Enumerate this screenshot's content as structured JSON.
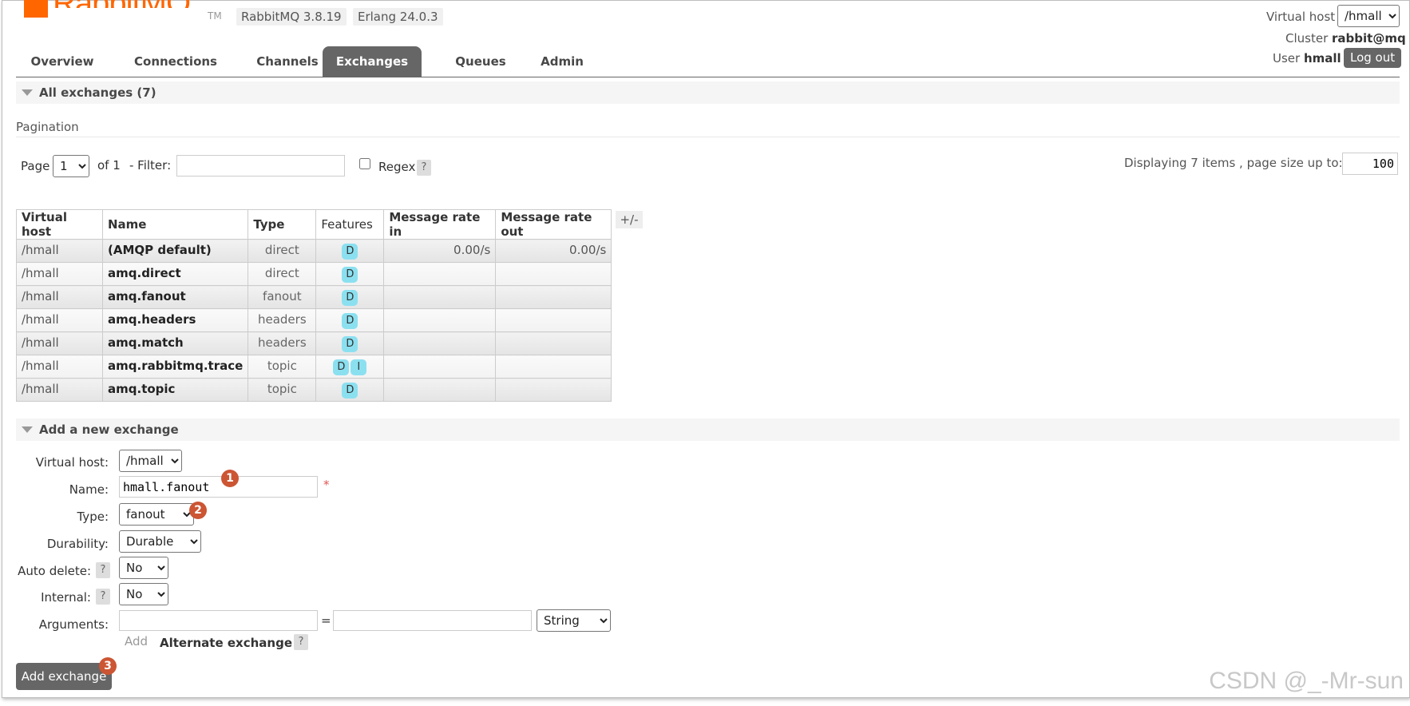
{
  "header": {
    "logo_text": "RabbitMQ",
    "logo_tm": "TM",
    "rabbitmq_version": "RabbitMQ 3.8.19",
    "erlang_version": "Erlang 24.0.3",
    "virtual_host_label": "Virtual host",
    "virtual_host_value": "/hmall",
    "cluster_label": "Cluster",
    "cluster_value": "rabbit@mq",
    "user_label": "User",
    "user_value": "hmall",
    "logout_label": "Log out"
  },
  "tabs": [
    {
      "label": "Overview"
    },
    {
      "label": "Connections"
    },
    {
      "label": "Channels"
    },
    {
      "label": "Exchanges",
      "active": true
    },
    {
      "label": "Queues"
    },
    {
      "label": "Admin"
    }
  ],
  "all_exchanges": {
    "title": "All exchanges (7)",
    "pagination_label": "Pagination",
    "page_label": "Page",
    "page_value": "1",
    "of_label": "of 1",
    "filter_label": "- Filter:",
    "filter_value": "",
    "regex_label": "Regex",
    "help_glyph": "?",
    "displaying_label": "Displaying 7 items , page size up to:",
    "page_size": "100",
    "plusminus": "+/-",
    "columns": [
      "Virtual host",
      "Name",
      "Type",
      "Features",
      "Message rate in",
      "Message rate out"
    ],
    "rows": [
      {
        "vhost": "/hmall",
        "name": "(AMQP default)",
        "type": "direct",
        "features": [
          "D"
        ],
        "rate_in": "0.00/s",
        "rate_out": "0.00/s"
      },
      {
        "vhost": "/hmall",
        "name": "amq.direct",
        "type": "direct",
        "features": [
          "D"
        ],
        "rate_in": "",
        "rate_out": ""
      },
      {
        "vhost": "/hmall",
        "name": "amq.fanout",
        "type": "fanout",
        "features": [
          "D"
        ],
        "rate_in": "",
        "rate_out": ""
      },
      {
        "vhost": "/hmall",
        "name": "amq.headers",
        "type": "headers",
        "features": [
          "D"
        ],
        "rate_in": "",
        "rate_out": ""
      },
      {
        "vhost": "/hmall",
        "name": "amq.match",
        "type": "headers",
        "features": [
          "D"
        ],
        "rate_in": "",
        "rate_out": ""
      },
      {
        "vhost": "/hmall",
        "name": "amq.rabbitmq.trace",
        "type": "topic",
        "features": [
          "D",
          "I"
        ],
        "rate_in": "",
        "rate_out": ""
      },
      {
        "vhost": "/hmall",
        "name": "amq.topic",
        "type": "topic",
        "features": [
          "D"
        ],
        "rate_in": "",
        "rate_out": ""
      }
    ]
  },
  "add_exchange": {
    "title": "Add a new exchange",
    "vhost_label": "Virtual host:",
    "vhost_value": "/hmall",
    "name_label": "Name:",
    "name_value": "hmall.fanout",
    "required_mark": "*",
    "type_label": "Type:",
    "type_value": "fanout",
    "durability_label": "Durability:",
    "durability_value": "Durable",
    "auto_delete_label": "Auto delete:",
    "auto_delete_value": "No",
    "internal_label": "Internal:",
    "internal_value": "No",
    "arguments_label": "Arguments:",
    "arg_key": "",
    "arg_equals": "=",
    "arg_value": "",
    "arg_type": "String",
    "add_link": "Add",
    "alternate_exchange": "Alternate exchange",
    "submit_label": "Add exchange"
  },
  "markers": [
    "1",
    "2",
    "3"
  ],
  "watermark": "CSDN @_-Mr-sun",
  "colors": {
    "brand": "#ff6600",
    "tab_active": "#666666",
    "badge": "#8be0f0",
    "marker": "#cc5533"
  }
}
